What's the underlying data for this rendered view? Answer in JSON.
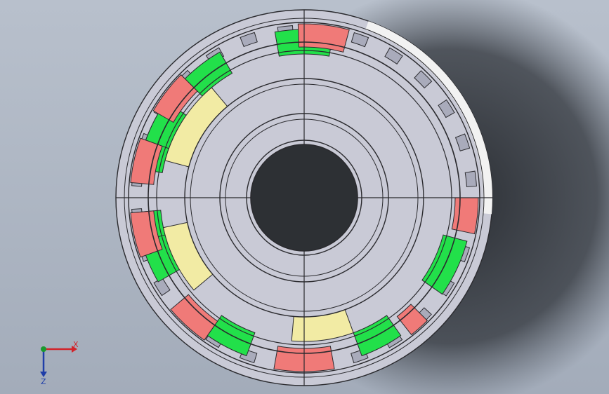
{
  "viewport": {
    "background_top": "#b4bcc8",
    "background_bottom": "#9ea8b6",
    "shadow_color": "#2b2f35"
  },
  "model": {
    "name": "",
    "colors": {
      "body": "#c9cad6",
      "body_dark": "#a9abbb",
      "edge": "#2a2a2e",
      "bore": "#2d3034",
      "green_part": "#22e04a",
      "red_part": "#f07a78",
      "yellow_part": "#f2eba4",
      "highlight_rim": "#f2f2f2"
    }
  },
  "triad": {
    "x_label": "X",
    "y_label": "",
    "z_label": "Z",
    "x_color": "#d2232a",
    "y_color": "#1a9a2e",
    "z_color": "#1f3ea8"
  }
}
